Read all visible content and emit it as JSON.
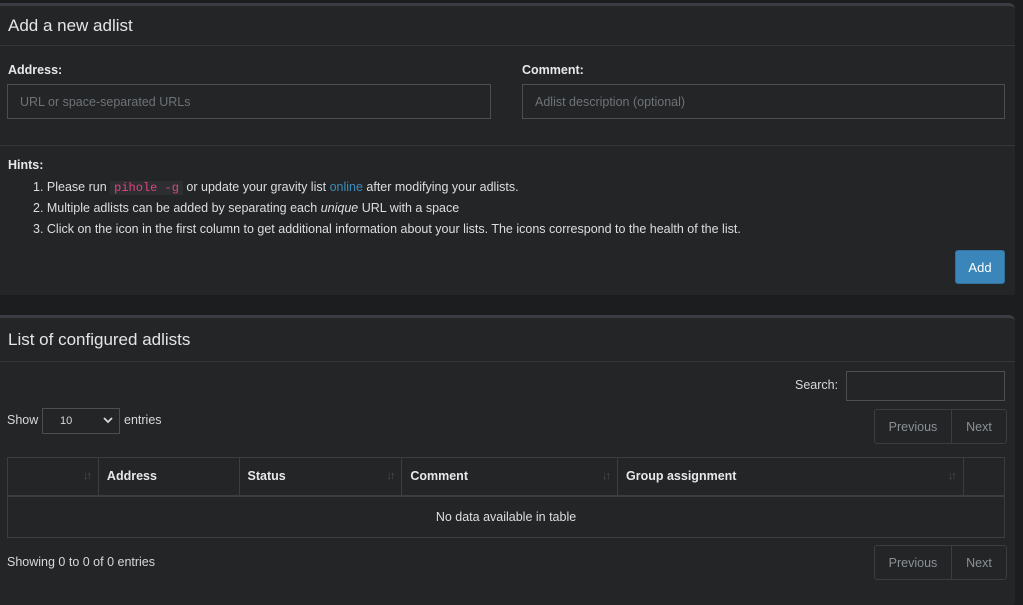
{
  "add_box": {
    "title": "Add a new adlist",
    "address_label": "Address:",
    "address_placeholder": "URL or space-separated URLs",
    "comment_label": "Comment:",
    "comment_placeholder": "Adlist description (optional)",
    "hints_title": "Hints:",
    "hint1_a": "1. Please run ",
    "hint1_code": "pihole -g",
    "hint1_b": " or update your gravity list ",
    "hint1_link": "online",
    "hint1_c": " after modifying your adlists.",
    "hint2_a": "2. Multiple adlists can be added by separating each ",
    "hint2_em": "unique",
    "hint2_b": " URL with a space",
    "hint3": "3. Click on the icon in the first column to get additional information about your lists. The icons correspond to the health of the list.",
    "add_button": "Add"
  },
  "list_box": {
    "title": "List of configured adlists",
    "search_label": "Search:",
    "show_label": "Show",
    "entries_select": "10",
    "entries_label": "entries",
    "previous_label": "Previous",
    "next_label": "Next",
    "columns": [
      "",
      "Address",
      "Status",
      "Comment",
      "Group assignment",
      ""
    ],
    "empty_text": "No data available in table",
    "info_text": "Showing 0 to 0 of 0 entries"
  },
  "colors": {
    "accent": "#3a86ba",
    "link": "#3c8dbc",
    "code": "#e0457b"
  }
}
